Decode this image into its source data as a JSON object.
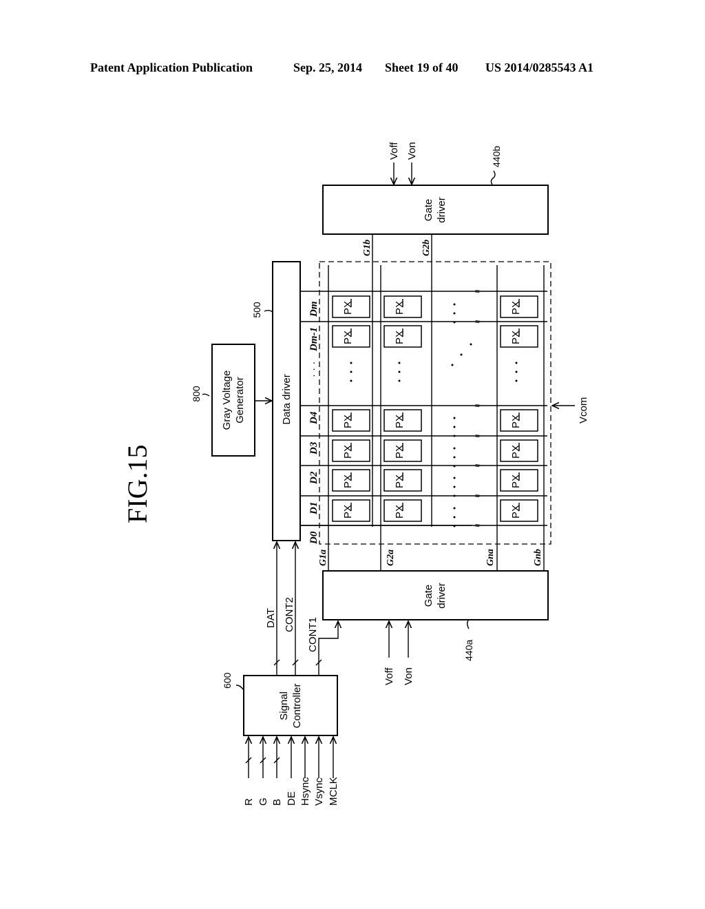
{
  "header": {
    "publication": "Patent Application Publication",
    "date": "Sep. 25, 2014",
    "sheet": "Sheet 19 of 40",
    "patent_number": "US 2014/0285543 A1"
  },
  "figure": {
    "title": "FIG.15",
    "gray_voltage_generator": {
      "label_line1": "Gray Voltage",
      "label_line2": "Generator",
      "ref": "800"
    },
    "data_driver": {
      "label": "Data driver",
      "ref": "500"
    },
    "gate_driver_b": {
      "label_line1": "Gate",
      "label_line2": "driver",
      "ref": "440b",
      "inputs": [
        "Voff",
        "Von"
      ]
    },
    "gate_driver_a": {
      "label_line1": "Gate",
      "label_line2": "driver",
      "ref": "440a",
      "inputs": [
        "Voff",
        "Von"
      ]
    },
    "signal_controller": {
      "label_line1": "Signal",
      "label_line2": "Controller",
      "ref": "600"
    },
    "controller_inputs": [
      "R",
      "G",
      "B",
      "DE",
      "Hsync",
      "Vsync",
      "MCLK"
    ],
    "controller_outputs": [
      "DAT",
      "CONT2",
      "CONT1"
    ],
    "data_lines": [
      "D0",
      "D1",
      "D2",
      "D3",
      "D4",
      "...",
      "Dm-1",
      "Dm"
    ],
    "gate_lines_top": [
      "G1b",
      "G2b"
    ],
    "gate_lines_bottom": [
      "G1a",
      "G2a",
      "Gna",
      "Gnb"
    ],
    "pixel_label": "PX",
    "common_voltage": "Vcom",
    "ellipsis": "· · ·"
  }
}
